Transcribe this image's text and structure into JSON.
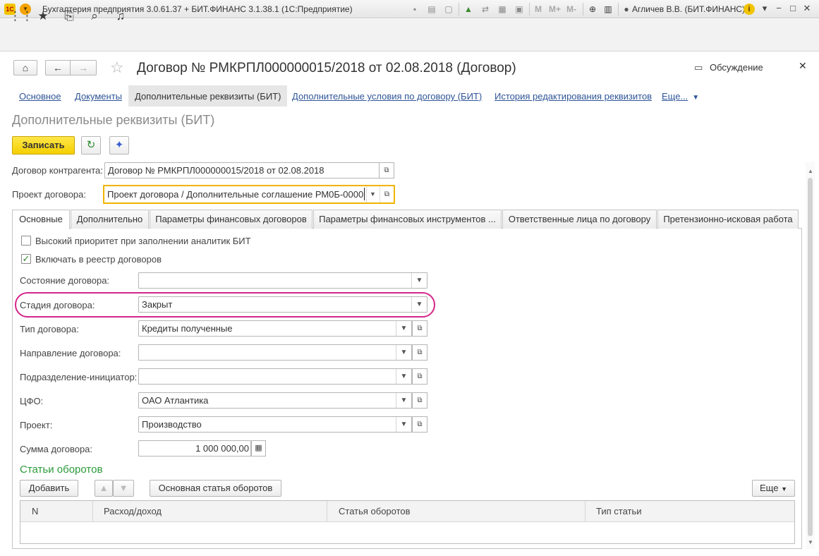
{
  "titlebar": {
    "logo": "1С",
    "app_title": "Бухгалтерия предприятия 3.0.61.37 + БИТ.ФИНАНС 3.1.38.1  (1С:Предприятие)",
    "m_labels": [
      "M",
      "M+",
      "M-"
    ],
    "user": "Агличев В.В. (БИТ.ФИНАНС)",
    "info": "i"
  },
  "form": {
    "title": "Договор № РМКРПЛ000000015/2018 от 02.08.2018 (Договор)",
    "discuss": "Обсуждение",
    "sections": {
      "main": "Основное",
      "documents": "Документы",
      "active": "Дополнительные реквизиты (БИТ)",
      "conditions": "Дополнительные условия по договору (БИТ)",
      "history": "История редактирования реквизитов",
      "more": "Еще..."
    },
    "heading": "Дополнительные реквизиты (БИТ)",
    "save_label": "Записать"
  },
  "fields": {
    "contract_label": "Договор контрагента:",
    "contract_value": "Договор № РМКРПЛ000000015/2018 от 02.08.2018",
    "project_label": "Проект договора:",
    "project_value": "Проект договора / Дополнительные соглашение РМ0Б-0000"
  },
  "tabs": [
    "Основные",
    "Дополнительно",
    "Параметры финансовых договоров",
    "Параметры финансовых инструментов ...",
    "Ответственные лица по договору",
    "Претензионно-исковая работа"
  ],
  "main_tab": {
    "cb_priority": {
      "label": "Высокий приоритет при заполнении аналитик БИТ",
      "checked": false
    },
    "cb_registry": {
      "label": "Включать в реестр договоров",
      "checked": true
    },
    "check_mark": "✓",
    "state_label": "Состояние договора:",
    "state_value": "",
    "stage_label": "Стадия договора:",
    "stage_value": "Закрыт",
    "type_label": "Тип договора:",
    "type_value": "Кредиты полученные",
    "direction_label": "Направление договора:",
    "direction_value": "",
    "division_label": "Подразделение-инициатор:",
    "division_value": "",
    "cfo_label": "ЦФО:",
    "cfo_value": "ОАО Атлантика",
    "project_label": "Проект:",
    "project_value": "Производство",
    "sum_label": "Сумма договора:",
    "sum_value": "1 000 000,00"
  },
  "turnover": {
    "heading": "Статьи оборотов",
    "add_label": "Добавить",
    "main_item_label": "Основная статья оборотов",
    "more_label": "Еще",
    "columns": [
      "N",
      "Расход/доход",
      "Статья оборотов",
      "Тип статьи"
    ]
  },
  "colors": {
    "accent_link": "#2f5597",
    "save_button": "#f4cf00",
    "highlight": "#d4268a",
    "subheading": "#2c9b3a",
    "project_field_border": "#f0b400"
  }
}
